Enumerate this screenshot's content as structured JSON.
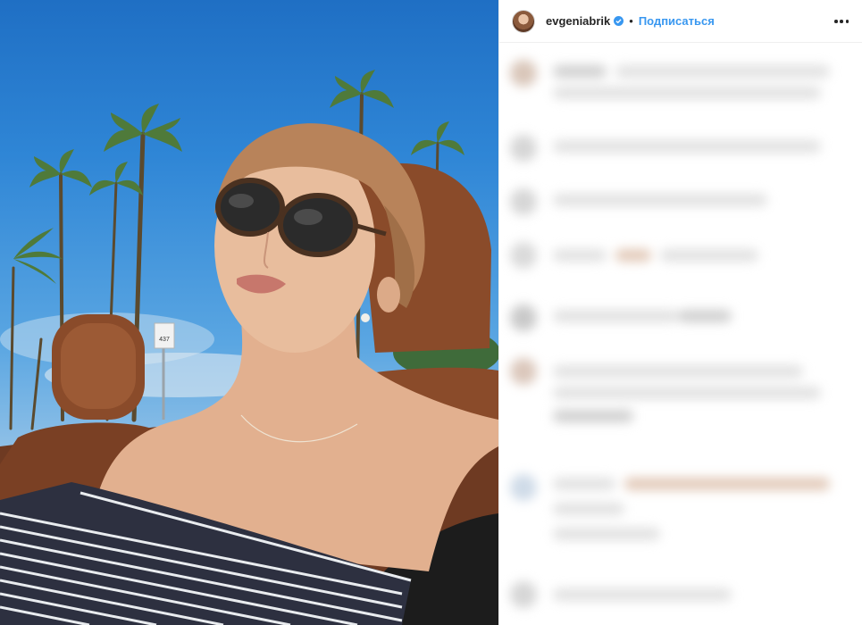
{
  "post": {
    "photo_alt": "Photo of woman in sunglasses in a convertible car",
    "street_sign": "437"
  },
  "header": {
    "username": "evgeniabrik",
    "separator": "•",
    "follow_label": "Подписаться"
  },
  "icons": {
    "verified": "verified-badge-icon",
    "more": "more-options-icon"
  },
  "colors": {
    "accent": "#3897f0",
    "text": "#262626",
    "seat_leather": "#8a4b2a"
  }
}
